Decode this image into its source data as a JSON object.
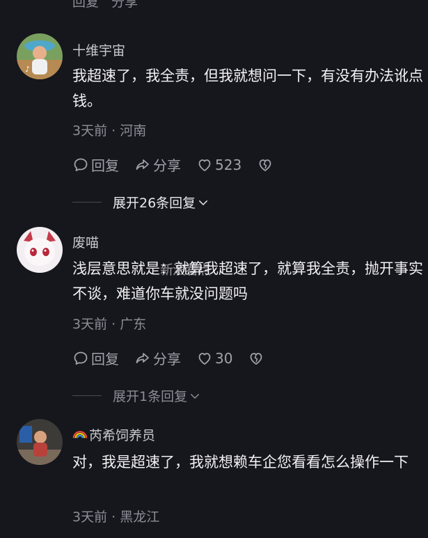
{
  "top_partial": {
    "reply_label": "回复",
    "share_label": "分享"
  },
  "comments": [
    {
      "username": "十维宇宙",
      "text": "我超速了，我全责，但我就想问一下，有没有办法讹点钱。",
      "meta": "3天前 · 河南",
      "reply_label": "回复",
      "share_label": "分享",
      "likes": "523",
      "expand_label": "展开26条回复"
    },
    {
      "username": "废喵",
      "text": "浅层意思就是：就算我超速了，就算我全责，抛开事实不谈，难道你车就没问题吗",
      "meta": "3天前 · 广东",
      "reply_label": "回复",
      "share_label": "分享",
      "likes": "30",
      "expand_label": "展开1条回复"
    },
    {
      "username": "芮希饲养员",
      "text": "对，我是超速了，我就想赖车企您看看怎么操作一下",
      "meta": "3天前 · 黑龙江"
    }
  ],
  "watermark": {
    "text": "新浪看点"
  },
  "colors": {
    "background": "#16161d",
    "text_primary": "#f1f1f4",
    "text_secondary": "#8e8e97"
  }
}
